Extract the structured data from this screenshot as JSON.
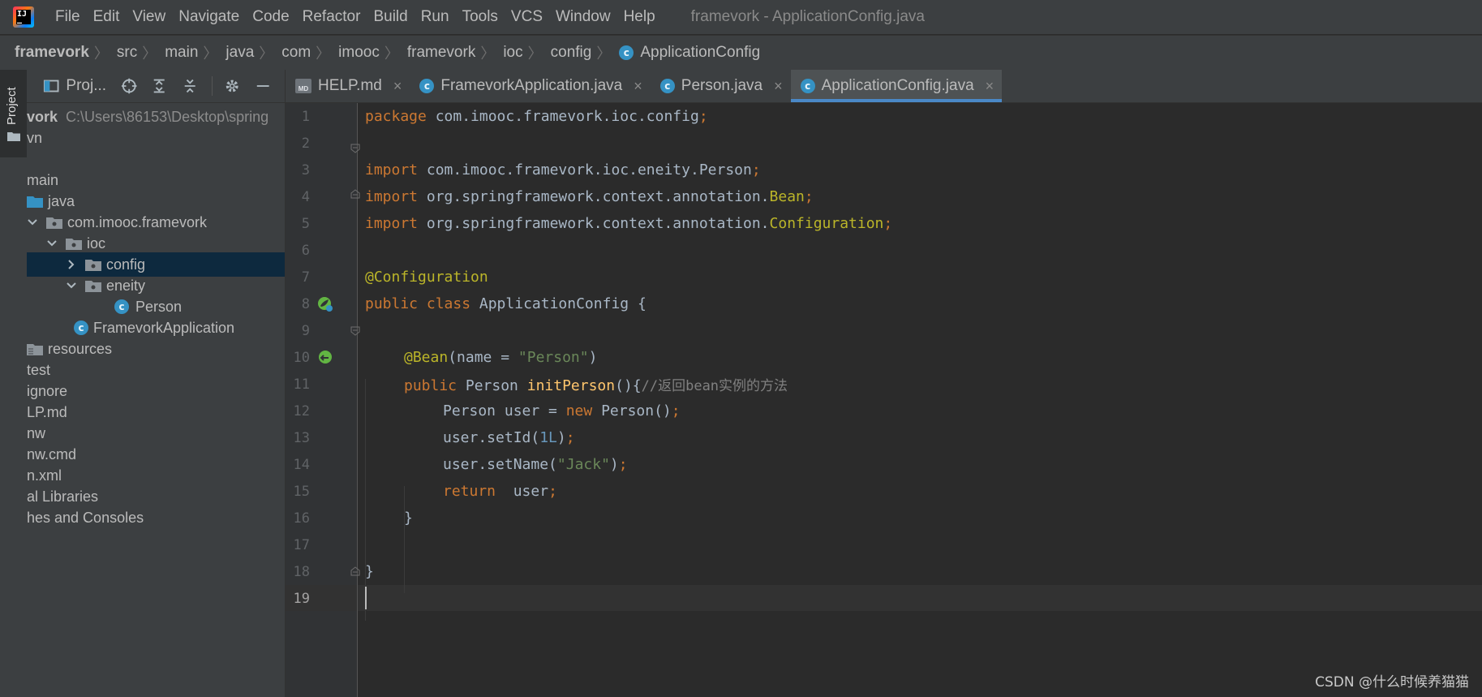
{
  "menubar": {
    "items": [
      "File",
      "Edit",
      "View",
      "Navigate",
      "Code",
      "Refactor",
      "Build",
      "Run",
      "Tools",
      "VCS",
      "Window",
      "Help"
    ],
    "window_title": "framevork - ApplicationConfig.java"
  },
  "breadcrumb": [
    "framevork",
    "src",
    "main",
    "java",
    "com",
    "imooc",
    "framevork",
    "ioc",
    "config",
    "ApplicationConfig"
  ],
  "side_strip": {
    "project_tab": "Project"
  },
  "project_panel": {
    "title": "Proj...",
    "tree": [
      {
        "label": "vork",
        "muted": "C:\\Users\\86153\\Desktop\\spring"
      },
      {
        "label": "vn"
      },
      {
        "label": ""
      },
      {
        "label": "main"
      },
      {
        "label": "java"
      },
      {
        "label": "com.imooc.framevork"
      },
      {
        "label": "ioc"
      },
      {
        "label": "config"
      },
      {
        "label": "eneity"
      },
      {
        "label": "Person"
      },
      {
        "label": "FramevorkApplication"
      },
      {
        "label": "resources"
      },
      {
        "label": "test"
      },
      {
        "label": "ignore"
      },
      {
        "label": "LP.md"
      },
      {
        "label": "nw"
      },
      {
        "label": "nw.cmd"
      },
      {
        "label": "n.xml"
      },
      {
        "label": "al Libraries"
      },
      {
        "label": "hes and Consoles"
      }
    ]
  },
  "tabs": [
    {
      "label": "HELP.md",
      "close": "×"
    },
    {
      "label": "FramevorkApplication.java",
      "close": "×"
    },
    {
      "label": "Person.java",
      "close": "×"
    },
    {
      "label": "ApplicationConfig.java",
      "close": "×"
    }
  ],
  "editor": {
    "line_numbers": [
      "1",
      "2",
      "3",
      "4",
      "5",
      "6",
      "7",
      "8",
      "9",
      "10",
      "11",
      "12",
      "13",
      "14",
      "15",
      "16",
      "17",
      "18",
      "19"
    ],
    "code": {
      "l1_kw": "package",
      "l1_rest": " com.imooc.framevork.ioc.config",
      "l3_kw": "import",
      "l3_rest": " com.imooc.framevork.ioc.eneity.Person",
      "l4_kw": "import",
      "l4_rest": " org.springframework.context.annotation.",
      "l4_cls": "Bean",
      "l5_kw": "import",
      "l5_rest": " org.springframework.context.annotation.",
      "l5_cls": "Configuration",
      "l7_ann": "@Configuration",
      "l8_kw": "public class",
      "l8_rest": " ApplicationConfig {",
      "l10_ann": "@Bean",
      "l10_open": "(name = ",
      "l10_str": "\"Person\"",
      "l10_close": ")",
      "l11_kw": "public",
      "l11_type": " Person ",
      "l11_fn": "initPerson",
      "l11_paren": "(){",
      "l11_cmt": "//返回bean实例的方法",
      "l12_a": "Person user = ",
      "l12_kw": "new",
      "l12_b": " Person()",
      "l13_a": "user.setId(",
      "l13_num": "1L",
      "l13_b": ")",
      "l14_a": "user.setName(",
      "l14_str": "\"Jack\"",
      "l14_b": ")",
      "l15_kw": "return",
      "l15_rest": "  user",
      "l16": "}",
      "l18": "}",
      "semicolon": ";"
    }
  },
  "watermark": "CSDN @什么时候养猫猫"
}
